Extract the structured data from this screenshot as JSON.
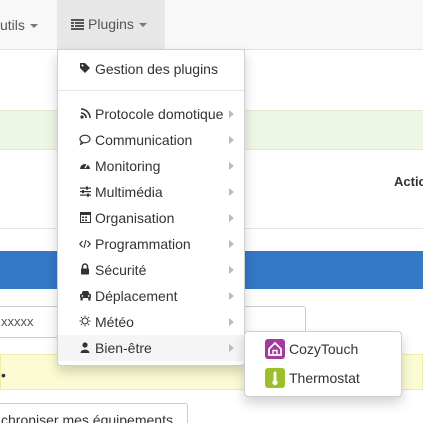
{
  "navbar": {
    "outils_label": "utils",
    "plugins_label": "Plugins"
  },
  "background": {
    "actions_header": "Actio",
    "input_value": "xxxxx",
    "alert_text": "•",
    "sync_button_label": "chroniser mes équipements"
  },
  "dropdown": {
    "top_item": {
      "label": "Gestion des plugins",
      "icon": "tags-icon"
    },
    "items": [
      {
        "label": "Protocole domotique",
        "icon": "rss-icon"
      },
      {
        "label": "Communication",
        "icon": "comment-icon"
      },
      {
        "label": "Monitoring",
        "icon": "tachometer-icon"
      },
      {
        "label": "Multimédia",
        "icon": "sliders-icon"
      },
      {
        "label": "Organisation",
        "icon": "calendar-icon"
      },
      {
        "label": "Programmation",
        "icon": "code-icon"
      },
      {
        "label": "Sécurité",
        "icon": "lock-icon"
      },
      {
        "label": "Déplacement",
        "icon": "car-icon"
      },
      {
        "label": "Météo",
        "icon": "sun-icon"
      },
      {
        "label": "Bien-être",
        "icon": "user-icon"
      }
    ]
  },
  "submenu": {
    "items": [
      {
        "label": "CozyTouch",
        "icon": "cozytouch-icon",
        "color": "#a23aa0"
      },
      {
        "label": "Thermostat",
        "icon": "thermostat-icon",
        "color": "#9cbf2c"
      }
    ]
  }
}
